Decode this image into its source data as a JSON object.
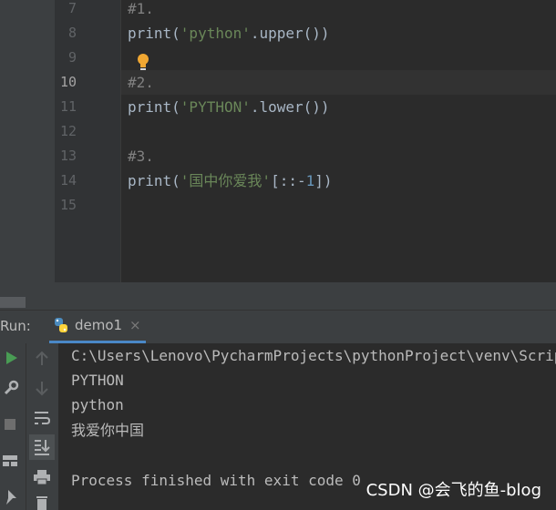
{
  "editor": {
    "lines": [
      {
        "no": "7"
      },
      {
        "no": "8"
      },
      {
        "no": "9"
      },
      {
        "no": "10"
      },
      {
        "no": "11"
      },
      {
        "no": "12"
      },
      {
        "no": "13"
      },
      {
        "no": "14"
      },
      {
        "no": "15"
      }
    ],
    "code": {
      "c1": "#1.",
      "l8_func": "print(",
      "l8_str": "'python'",
      "l8_tail": ".upper())",
      "c2": "#2.",
      "l11_func": "print(",
      "l11_str": "'PYTHON'",
      "l11_tail": ".lower())",
      "c3": "#3.",
      "l14_func": "print(",
      "l14_str": "'国中你爱我'",
      "l14_mid": "[::-",
      "l14_num": "1",
      "l14_tail": "])"
    }
  },
  "run_window": {
    "label": "Run:",
    "tab_label": "demo1",
    "tab_close": "×"
  },
  "console": {
    "lines": [
      "C:\\Users\\Lenovo\\PycharmProjects\\pythonProject\\venv\\Scripts\\python.exe",
      "PYTHON",
      "python",
      "我爱你中国",
      "",
      "Process finished with exit code 0"
    ]
  },
  "watermark": "CSDN @会飞的鱼-blog",
  "icons": [
    "lightbulb-icon",
    "python-file-icon",
    "run-icon",
    "wrench-icon",
    "stop-icon",
    "layout-icon",
    "pin-icon",
    "up-arrow-icon",
    "down-arrow-icon",
    "soft-wrap-icon",
    "scroll-to-end-icon",
    "print-icon",
    "trash-icon"
  ]
}
